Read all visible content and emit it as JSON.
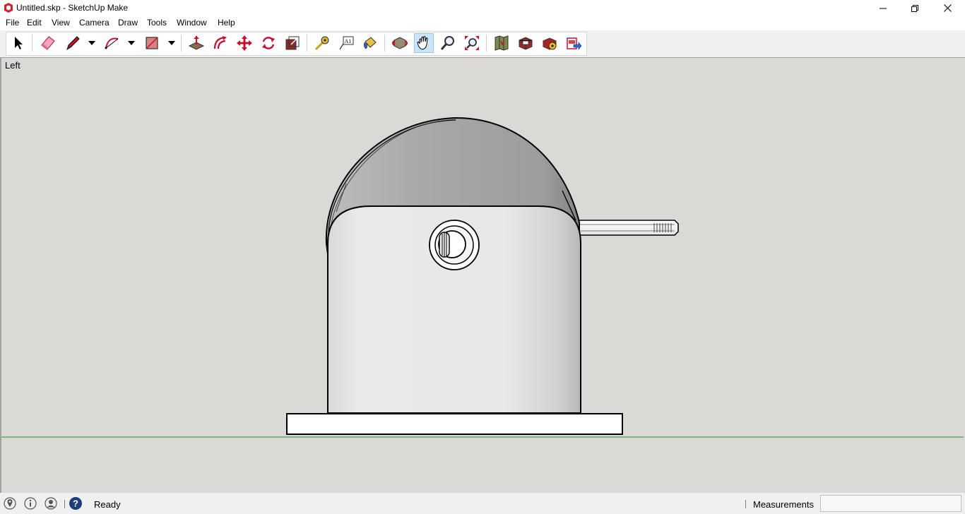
{
  "window": {
    "title": "Untitled.skp - SketchUp Make"
  },
  "menu": {
    "items": [
      "File",
      "Edit",
      "View",
      "Camera",
      "Draw",
      "Tools",
      "Window",
      "Help"
    ]
  },
  "toolbar": {
    "tools": [
      {
        "name": "select-icon"
      },
      {
        "name": "eraser-icon"
      },
      {
        "name": "line-icon"
      },
      {
        "name": "arc-icon"
      },
      {
        "name": "rectangle-icon"
      },
      {
        "name": "push-pull-icon"
      },
      {
        "name": "offset-icon"
      },
      {
        "name": "move-icon"
      },
      {
        "name": "rotate-icon"
      },
      {
        "name": "scale-icon"
      },
      {
        "name": "tape-measure-icon"
      },
      {
        "name": "text-icon"
      },
      {
        "name": "paint-bucket-icon"
      },
      {
        "name": "orbit-icon"
      },
      {
        "name": "pan-icon",
        "active": true
      },
      {
        "name": "zoom-icon"
      },
      {
        "name": "zoom-extents-icon"
      },
      {
        "name": "warehouse-icon"
      },
      {
        "name": "share-model-icon"
      },
      {
        "name": "extension-warehouse-icon"
      },
      {
        "name": "send-to-layout-icon"
      }
    ],
    "text_tool_glyph": "A1"
  },
  "viewport": {
    "view_name": "Left",
    "background_color": "#dad9d5",
    "ground_line_color": "#1f9a3a"
  },
  "statusbar": {
    "status": "Ready",
    "measurements_label": "Measurements",
    "measurements_value": ""
  }
}
